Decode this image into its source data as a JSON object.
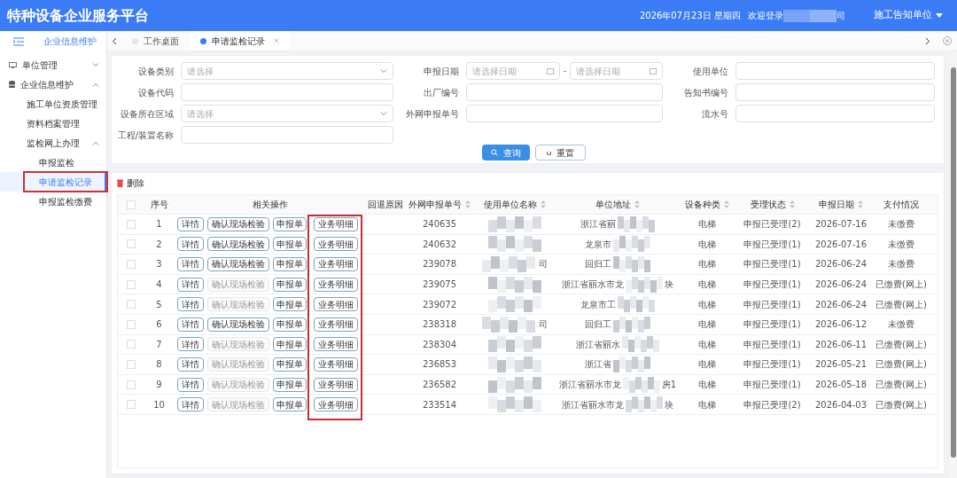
{
  "header": {
    "title": "特种设备企业服务平台",
    "date": "2026年07月23日 星期四",
    "welcome": "欢迎登录",
    "welcome_tail": "司",
    "role": "施工告知单位"
  },
  "sidebar": {
    "module": "企业信息维护",
    "items": [
      {
        "label": "单位管理",
        "kind": "group",
        "expanded": false
      },
      {
        "label": "企业信息维护",
        "kind": "group",
        "expanded": true,
        "children": [
          {
            "label": "施工单位资质管理",
            "kind": "item",
            "selected": false
          },
          {
            "label": "资料档案管理",
            "kind": "item",
            "selected": false
          },
          {
            "label": "监检网上办理",
            "kind": "group",
            "expanded": true,
            "children": [
              {
                "label": "申报监检",
                "kind": "item",
                "selected": false
              },
              {
                "label": "申请监检记录",
                "kind": "item",
                "selected": true
              },
              {
                "label": "申报监检缴费",
                "kind": "item",
                "selected": false
              }
            ]
          }
        ]
      }
    ]
  },
  "tabs": [
    {
      "label": "工作桌面",
      "selected": false,
      "closable": false
    },
    {
      "label": "申请监检记录",
      "selected": true,
      "closable": true
    }
  ],
  "filters": [
    {
      "label": "设备类别",
      "kind": "select",
      "placeholder": "请选择"
    },
    {
      "label": "申报日期",
      "kind": "daterange",
      "placeholder": "请选择日期",
      "placeholder_end": "请选择日期"
    },
    {
      "label": "使用单位",
      "kind": "text"
    },
    {
      "label": "设备代码",
      "kind": "text"
    },
    {
      "label": "出厂编号",
      "kind": "text"
    },
    {
      "label": "告知书编号",
      "kind": "text"
    },
    {
      "label": "设备所在区域",
      "kind": "select",
      "placeholder": "请选择"
    },
    {
      "label": "外网申报单号",
      "kind": "text"
    },
    {
      "label": "流水号",
      "kind": "text"
    },
    {
      "label": "工程/装置名称",
      "kind": "text"
    }
  ],
  "search_button": "查询",
  "reset_button": "重置",
  "delete_button": "删除",
  "table": {
    "all_checked": false,
    "columns": [
      {
        "label": "序号",
        "sortable": false
      },
      {
        "label": "相关操作",
        "sortable": false
      },
      {
        "label": "回退原因",
        "sortable": false
      },
      {
        "label": "外网申报单号",
        "sortable": true
      },
      {
        "label": "使用单位名称",
        "sortable": true
      },
      {
        "label": "单位地址",
        "sortable": true
      },
      {
        "label": "设备种类",
        "sortable": true
      },
      {
        "label": "受理状态",
        "sortable": true
      },
      {
        "label": "申报日期",
        "sortable": true
      },
      {
        "label": "支付情况",
        "sortable": false
      }
    ],
    "rows": [
      {
        "index": "1",
        "checked": false,
        "actions": [
          {
            "label": "详情",
            "disabled": false
          },
          {
            "label": "确认现场检验",
            "disabled": false
          },
          {
            "label": "申报单",
            "disabled": false
          },
          {
            "label": "业务明细",
            "disabled": false
          }
        ],
        "number": "240635",
        "name_tail": "",
        "address": "浙江省丽",
        "address_tail": "",
        "type": "电梯",
        "status": "申报已受理(2)",
        "date": "2026-07-16",
        "payment": "未缴费"
      },
      {
        "index": "2",
        "checked": false,
        "actions": [
          {
            "label": "详情",
            "disabled": false
          },
          {
            "label": "确认现场检验",
            "disabled": false
          },
          {
            "label": "申报单",
            "disabled": false
          },
          {
            "label": "业务明细",
            "disabled": false
          }
        ],
        "number": "240632",
        "name_tail": "",
        "address": "龙泉市",
        "address_tail": "",
        "type": "电梯",
        "status": "申报已受理(1)",
        "date": "2026-07-16",
        "payment": "未缴费"
      },
      {
        "index": "3",
        "checked": false,
        "actions": [
          {
            "label": "详情",
            "disabled": false
          },
          {
            "label": "确认现场检验",
            "disabled": false
          },
          {
            "label": "申报单",
            "disabled": false
          },
          {
            "label": "业务明细",
            "disabled": false
          }
        ],
        "number": "239078",
        "name_tail": "司",
        "address": "回归工",
        "address_tail": "",
        "type": "电梯",
        "status": "申报已受理(1)",
        "date": "2026-06-24",
        "payment": "未缴费"
      },
      {
        "index": "4",
        "checked": false,
        "actions": [
          {
            "label": "详情",
            "disabled": false
          },
          {
            "label": "确认现场检验",
            "disabled": true
          },
          {
            "label": "申报单",
            "disabled": false
          },
          {
            "label": "业务明细",
            "disabled": false
          }
        ],
        "number": "239075",
        "name_tail": "",
        "address": "浙江省丽水市龙",
        "address_tail": "块",
        "type": "电梯",
        "status": "申报已受理(1)",
        "date": "2026-06-24",
        "payment": "已缴费(网上)"
      },
      {
        "index": "5",
        "checked": false,
        "actions": [
          {
            "label": "详情",
            "disabled": false
          },
          {
            "label": "确认现场检验",
            "disabled": true
          },
          {
            "label": "申报单",
            "disabled": false
          },
          {
            "label": "业务明细",
            "disabled": false
          }
        ],
        "number": "239072",
        "name_tail": "",
        "address": "龙泉市工",
        "address_tail": "",
        "type": "电梯",
        "status": "申报已受理(1)",
        "date": "2026-06-24",
        "payment": "已缴费(网上)"
      },
      {
        "index": "6",
        "checked": false,
        "actions": [
          {
            "label": "详情",
            "disabled": false
          },
          {
            "label": "确认现场检验",
            "disabled": false
          },
          {
            "label": "申报单",
            "disabled": false
          },
          {
            "label": "业务明细",
            "disabled": false
          }
        ],
        "number": "238318",
        "name_tail": "司",
        "address": "回归工",
        "address_tail": "",
        "type": "电梯",
        "status": "申报已受理(1)",
        "date": "2026-06-12",
        "payment": "未缴费"
      },
      {
        "index": "7",
        "checked": false,
        "actions": [
          {
            "label": "详情",
            "disabled": false
          },
          {
            "label": "确认现场检验",
            "disabled": true
          },
          {
            "label": "申报单",
            "disabled": false
          },
          {
            "label": "业务明细",
            "disabled": false
          }
        ],
        "number": "238304",
        "name_tail": "",
        "address": "浙江省丽水",
        "address_tail": "",
        "type": "电梯",
        "status": "申报已受理(1)",
        "date": "2026-06-11",
        "payment": "已缴费(网上)"
      },
      {
        "index": "8",
        "checked": false,
        "actions": [
          {
            "label": "详情",
            "disabled": false
          },
          {
            "label": "确认现场检验",
            "disabled": true
          },
          {
            "label": "申报单",
            "disabled": false
          },
          {
            "label": "业务明细",
            "disabled": false
          }
        ],
        "number": "236853",
        "name_tail": "",
        "address": "浙江省",
        "address_tail": "",
        "type": "电梯",
        "status": "申报已受理(1)",
        "date": "2026-05-21",
        "payment": "已缴费(网上)"
      },
      {
        "index": "9",
        "checked": false,
        "actions": [
          {
            "label": "详情",
            "disabled": false
          },
          {
            "label": "确认现场检验",
            "disabled": true
          },
          {
            "label": "申报单",
            "disabled": false
          },
          {
            "label": "业务明细",
            "disabled": false
          }
        ],
        "number": "236582",
        "name_tail": "",
        "address": "浙江省丽水市龙",
        "address_tail": "房1",
        "type": "电梯",
        "status": "申报已受理(1)",
        "date": "2026-05-18",
        "payment": "已缴费(网上)"
      },
      {
        "index": "10",
        "checked": false,
        "actions": [
          {
            "label": "详情",
            "disabled": false
          },
          {
            "label": "确认现场检验",
            "disabled": true
          },
          {
            "label": "申报单",
            "disabled": false
          },
          {
            "label": "业务明细",
            "disabled": false
          }
        ],
        "number": "233514",
        "name_tail": "",
        "address": "浙江省丽水市龙",
        "address_tail": "块",
        "type": "电梯",
        "status": "申报已受理(2)",
        "date": "2026-04-03",
        "payment": "已缴费(网上)"
      }
    ]
  }
}
